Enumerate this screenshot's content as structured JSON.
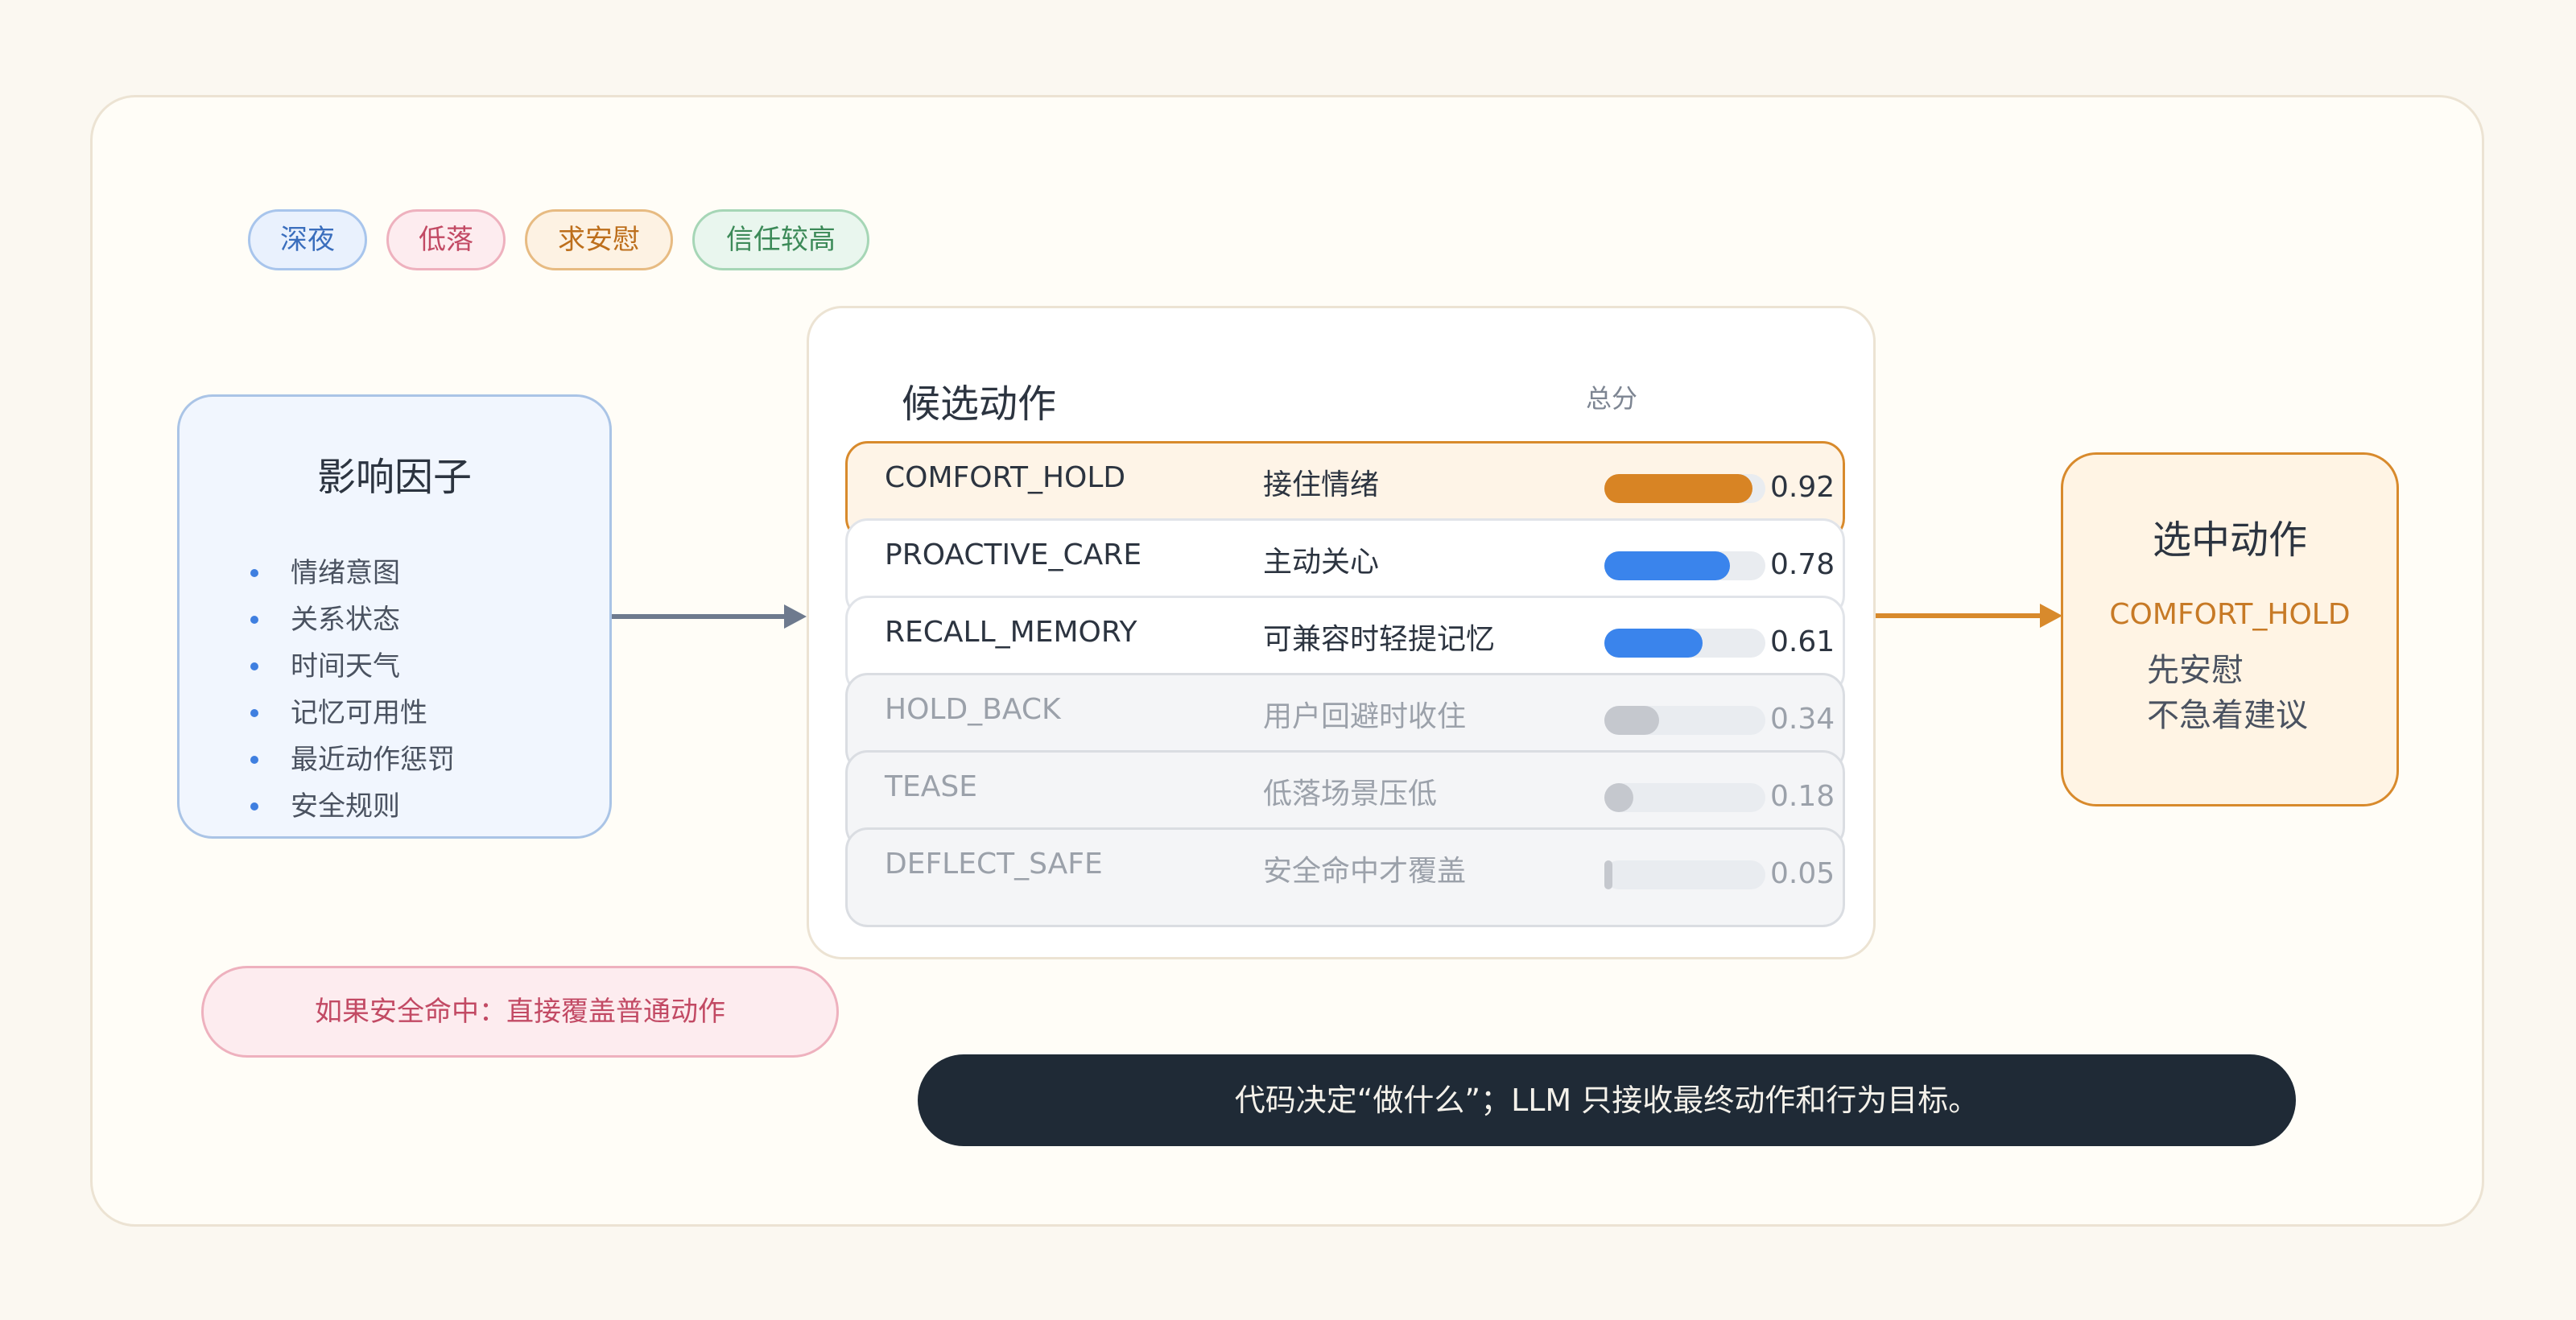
{
  "tags": [
    {
      "label": "深夜",
      "tone": "blue"
    },
    {
      "label": "低落",
      "tone": "red"
    },
    {
      "label": "求安慰",
      "tone": "orange"
    },
    {
      "label": "信任较高",
      "tone": "green"
    }
  ],
  "factors": {
    "title": "影响因子",
    "items": [
      "情绪意图",
      "关系状态",
      "时间天气",
      "记忆可用性",
      "最近动作惩罚",
      "安全规则"
    ]
  },
  "candidates": {
    "title": "候选动作",
    "score_header": "总分",
    "rows": [
      {
        "code": "COMFORT_HOLD",
        "label": "接住情绪",
        "score_text": "0.92",
        "score": 0.92,
        "color": "#d88424",
        "state": "selected"
      },
      {
        "code": "PROACTIVE_CARE",
        "label": "主动关心",
        "score_text": "0.78",
        "score": 0.78,
        "color": "#3a84ec",
        "state": "normal"
      },
      {
        "code": "RECALL_MEMORY",
        "label": "可兼容时轻提记忆",
        "score_text": "0.61",
        "score": 0.61,
        "color": "#3a84ec",
        "state": "normal"
      },
      {
        "code": "HOLD_BACK",
        "label": "用户回避时收住",
        "score_text": "0.34",
        "score": 0.34,
        "color": "#c5c8ce",
        "state": "faded"
      },
      {
        "code": "TEASE",
        "label": "低落场景压低",
        "score_text": "0.18",
        "score": 0.18,
        "color": "#c5c8ce",
        "state": "faded"
      },
      {
        "code": "DEFLECT_SAFE",
        "label": "安全命中才覆盖",
        "score_text": "0.05",
        "score": 0.05,
        "color": "#c5c8ce",
        "state": "faded"
      }
    ]
  },
  "selected": {
    "title": "选中动作",
    "code": "COMFORT_HOLD",
    "note_line1": "先安慰",
    "note_line2": "不急着建议"
  },
  "override_note": "如果安全命中：直接覆盖普通动作",
  "footer_note": "代码决定“做什么”；LLM 只接收最终动作和行为目标。",
  "colors": {
    "accent_orange": "#d88a2c",
    "accent_blue": "#3a84ec",
    "arrow_gray": "#6e7a8e",
    "footer_bg": "#1f2a36"
  }
}
